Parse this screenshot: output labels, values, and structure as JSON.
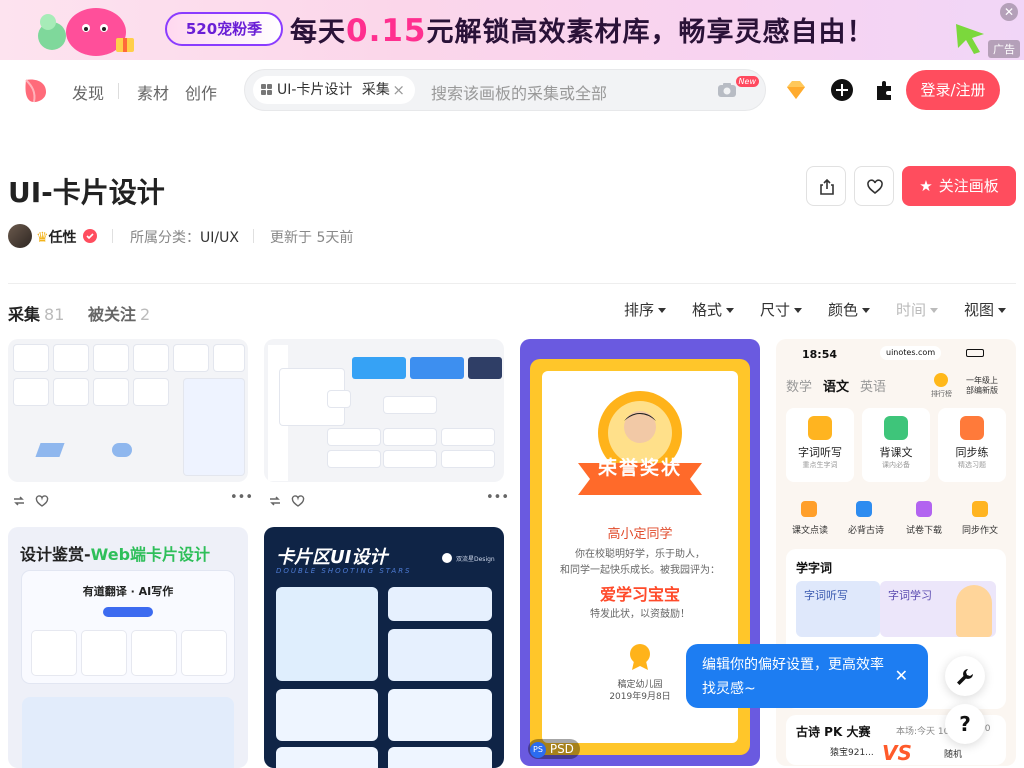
{
  "banner": {
    "campaign": "520宠粉季",
    "headline_pre": "每天",
    "headline_price": "0.15",
    "headline_post": "元解锁高效素材库，畅享灵感自由！",
    "ad_tag": "广告"
  },
  "nav": {
    "discover": "发现",
    "materials": "素材",
    "create": "创作",
    "search_chip": "UI-卡片设计",
    "search_chip_suffix": "采集",
    "search_placeholder": "搜索该画板的采集或全部",
    "new_badge": "New",
    "login": "登录/注册"
  },
  "board": {
    "title": "UI-卡片设计",
    "owner": "任性",
    "category_label": "所属分类：",
    "category": "UI/UX",
    "updated": "更新于 5天前",
    "follow": "关注画板"
  },
  "tabs": [
    {
      "label": "采集",
      "count": "81"
    },
    {
      "label": "被关注",
      "count": "2"
    }
  ],
  "filters": [
    "排序",
    "格式",
    "尺寸",
    "颜色",
    "时间",
    "视图"
  ],
  "cards": {
    "c3_title": "荣誉奖状",
    "c3_name": "高小定同学",
    "c3_body1": "你在校聪明好学，乐于助人，",
    "c3_body2": "和同学一起快乐成长。被我园评为：",
    "c3_award": "爱学习宝宝",
    "c3_footer": "特发此状，以资鼓励！",
    "c3_school": "稿定幼儿园",
    "c3_date": "2019年9月8日",
    "c3_format": "PSD",
    "c4_time": "18:54",
    "c4_site": "uinotes.com",
    "c4_tabs": [
      "数学",
      "语文",
      "英语"
    ],
    "c4_rank": "排行榜",
    "c4_grade": "一年级上",
    "c4_grade2": "部编新版",
    "c4_tiles": [
      {
        "t": "字词听写",
        "s": "重点生字词"
      },
      {
        "t": "背课文",
        "s": "课内必备"
      },
      {
        "t": "同步练",
        "s": "精选习题"
      }
    ],
    "c4_small": [
      "课文点读",
      "必背古诗",
      "试卷下载",
      "同步作文"
    ],
    "c4_section": "学字词",
    "c4_sub": [
      "字词听写",
      "字词学习"
    ],
    "c4_bottom": "古诗 PK 大赛",
    "c4_bottom_right": "本场:今天 10:",
    "c4_bottom_right2": "00",
    "c4_bottom_name": "猿宝921...",
    "c4_bottom_vs": "VS",
    "c4_bottom_random": "随机",
    "c5_title_a": "设计鉴赏-",
    "c5_title_b": "Web端卡片设计",
    "c5_product": "有道翻译 · AI写作",
    "c6_title": "卡片区UI设计",
    "c6_sub": "DOUBLE SHOOTING STARS",
    "c6_brand": "双流星Design"
  },
  "tooltip": "编辑你的偏好设置，更高效率找灵感~",
  "colors": {
    "accent": "#ff4d5e",
    "tooltip": "#1d7df2",
    "award": "#ff4a2a"
  }
}
